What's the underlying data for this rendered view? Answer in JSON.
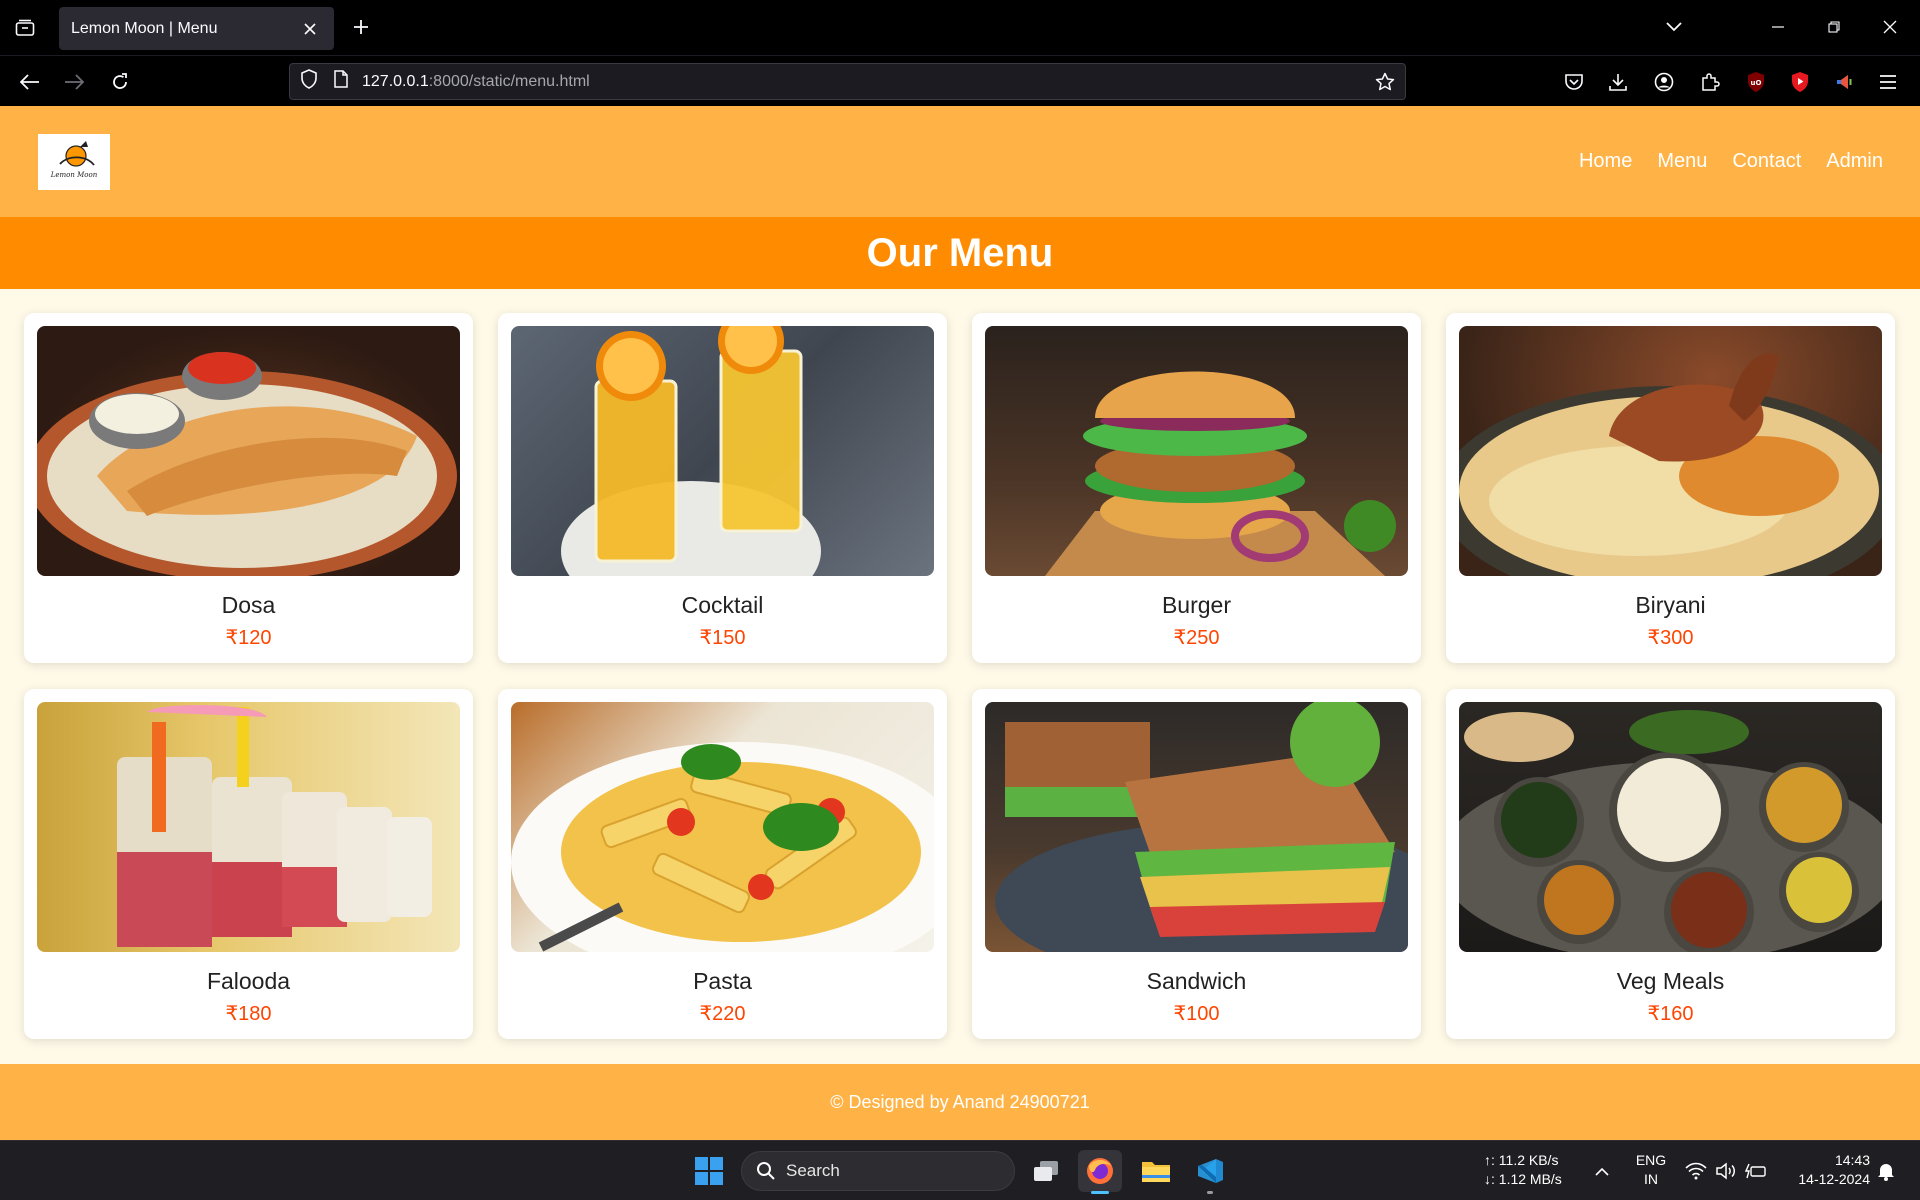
{
  "browser": {
    "tab_title": "Lemon Moon | Menu",
    "url_host": "127.0.0.1",
    "url_path": ":8000/static/menu.html"
  },
  "site": {
    "logo_text": "Lemon Moon",
    "nav": [
      {
        "label": "Home"
      },
      {
        "label": "Menu"
      },
      {
        "label": "Contact"
      },
      {
        "label": "Admin"
      }
    ],
    "heading": "Our Menu",
    "items": [
      {
        "name": "Dosa",
        "price": "₹120"
      },
      {
        "name": "Cocktail",
        "price": "₹150"
      },
      {
        "name": "Burger",
        "price": "₹250"
      },
      {
        "name": "Biryani",
        "price": "₹300"
      },
      {
        "name": "Falooda",
        "price": "₹180"
      },
      {
        "name": "Pasta",
        "price": "₹220"
      },
      {
        "name": "Sandwich",
        "price": "₹100"
      },
      {
        "name": "Veg Meals",
        "price": "₹160"
      }
    ],
    "footer": "© Designed by Anand 24900721"
  },
  "taskbar": {
    "search_label": "Search",
    "net_up": "↑: 11.2 KB/s",
    "net_down": "↓: 1.12 MB/s",
    "lang_1": "ENG",
    "lang_2": "IN",
    "time": "14:43",
    "date": "14-12-2024"
  },
  "colors": {
    "header": "#ffb347",
    "banner": "#ff8c00",
    "price": "#ff4500",
    "page_bg": "#fff9e8"
  }
}
